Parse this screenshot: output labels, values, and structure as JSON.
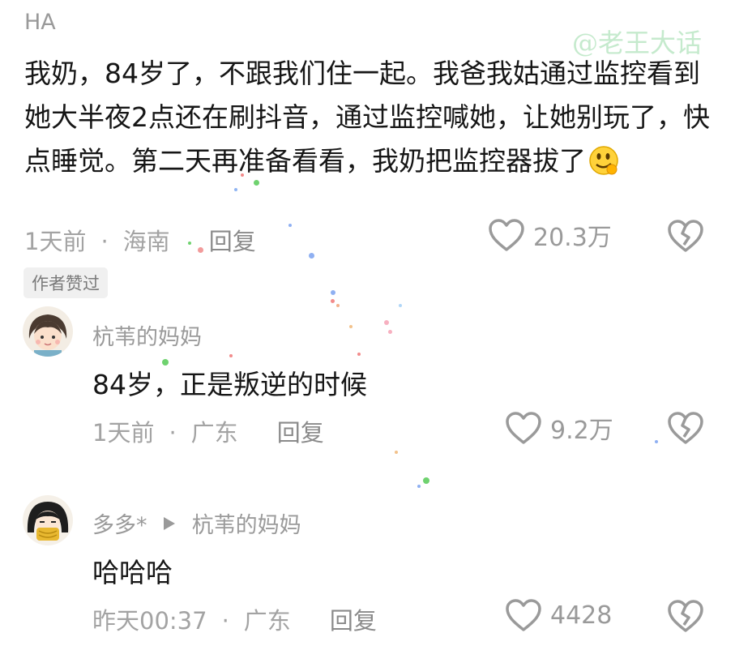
{
  "watermark": "@老王大话",
  "post": {
    "author": "HA",
    "text": "我奶，84岁了，不跟我们住一起。我爸我姑通过监控看到她大半夜2点还在刷抖音，通过监控喊她，让她别玩了，快点睡觉。第二天再准备看看，我奶把监控器拔了",
    "time": "1天前",
    "location": "海南",
    "reply_label": "回复",
    "likes": "20.3万",
    "badge": "作者赞过"
  },
  "replies": [
    {
      "author": "杭苇的妈妈",
      "reply_to": "",
      "text": "84岁，正是叛逆的时候",
      "time": "1天前",
      "location": "广东",
      "reply_label": "回复",
      "likes": "9.2万"
    },
    {
      "author": "多多*",
      "reply_to": "杭苇的妈妈",
      "text": "哈哈哈",
      "time": "昨天00:37",
      "location": "广东",
      "reply_label": "回复",
      "likes": "4428"
    }
  ],
  "separator": "·",
  "icons": {
    "like": "heart-outline-icon",
    "dislike": "broken-heart-icon",
    "reply_arrow": "play-triangle-icon",
    "emoji": "smirk-emoji-icon"
  },
  "colors": {
    "meta_text": "#a3a3a3",
    "watermark": "#bfe8c8",
    "badge_bg": "#f0f0f0"
  }
}
